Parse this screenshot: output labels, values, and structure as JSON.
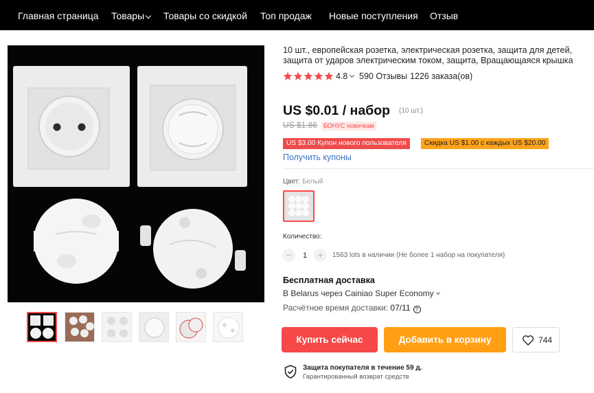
{
  "nav": {
    "items": [
      {
        "label": "Главная страница",
        "has_dropdown": false
      },
      {
        "label": "Товары",
        "has_dropdown": true
      },
      {
        "label": "Товары со скидкой",
        "has_dropdown": false
      },
      {
        "label": "Топ продаж",
        "has_dropdown": false
      },
      {
        "label": "Новые поступления",
        "has_dropdown": false
      },
      {
        "label": "Отзыв",
        "has_dropdown": false
      }
    ]
  },
  "product": {
    "title": "10 шт., европейская розетка, электрическая розетка, защита для детей, защита от ударов электрическим током, защита, Вращающаяся крышка",
    "rating": "4.8",
    "reviews": "590 Отзывы",
    "orders": "1226 заказа(ов)",
    "price": "US $0.01 / набор",
    "price_unit": "(10 шт.)",
    "old_price": "US $1.86",
    "bonus_badge": "БОНУС новичкам",
    "coupon_new_user": "US $3.00 Купон нового пользователя",
    "coupon_discount": "Скидка US $1.00 с каждых US $20.00",
    "get_coupons": "Получить купоны",
    "color_label": "Цвет:",
    "color_value": "Белый",
    "quantity_label": "Количество:",
    "quantity_value": "1",
    "stock": "1563 lots в наличии (Не более 1 набор на покупателя)"
  },
  "shipping": {
    "title": "Бесплатная доставка",
    "destination": "В Belarus через Cainiao Super Economy",
    "eta_label": "Расчётное время доставки:",
    "eta_value": "07/11"
  },
  "actions": {
    "buy_now": "Купить сейчас",
    "add_to_cart": "Добавить в корзину",
    "wishlist_count": "744"
  },
  "protection": {
    "title": "Защита покупателя в течение 59 д.",
    "subtitle": "Гарантированный возврат средств"
  },
  "colors": {
    "accent_red": "#f64848",
    "accent_orange": "#ff9f13",
    "link_blue": "#3b74c6",
    "star": "#f04a4a"
  }
}
